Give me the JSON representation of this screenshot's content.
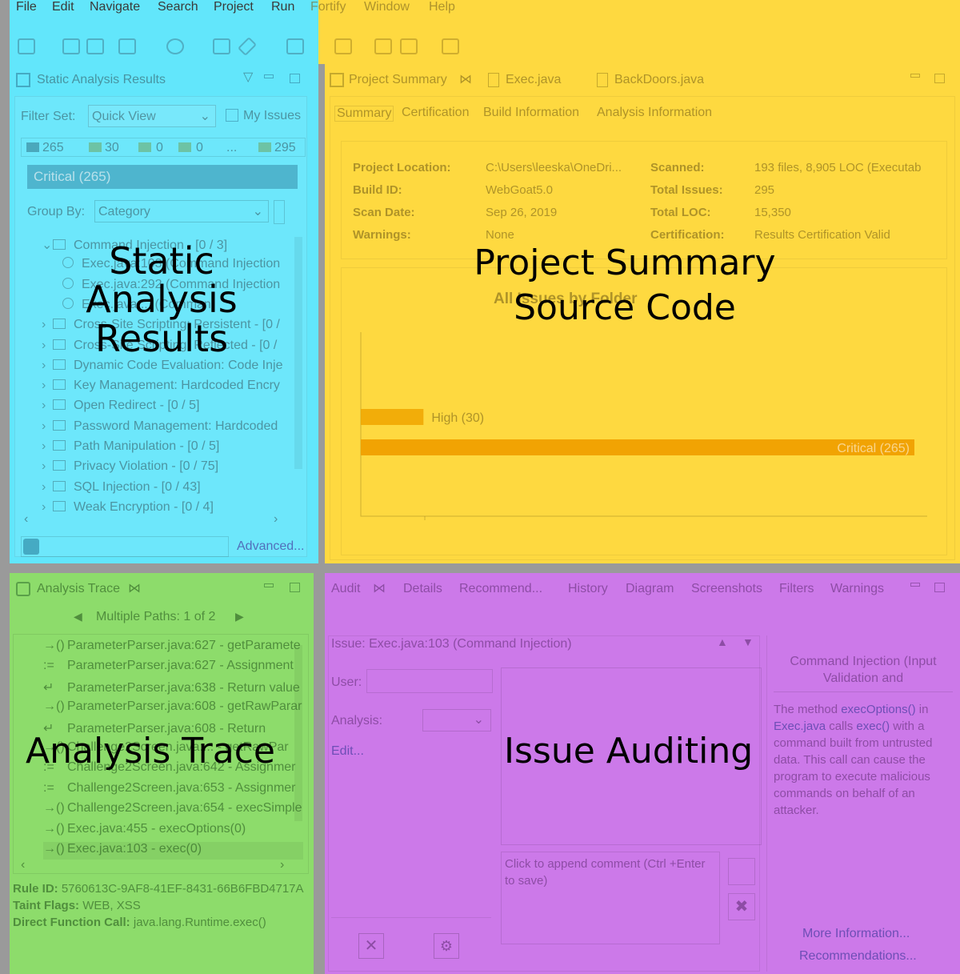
{
  "menu": [
    "File",
    "Edit",
    "Navigate",
    "Search",
    "Project",
    "Run",
    "Fortify",
    "Window",
    "Help"
  ],
  "static_panel": {
    "title": "Static Analysis Results",
    "filter_label": "Filter Set:",
    "filter_value": "Quick View",
    "my_issues": "My Issues",
    "counts": [
      "265",
      "30",
      "0",
      "0",
      "...",
      "295"
    ],
    "critical_bar": "Critical (265)",
    "group_by_label": "Group By:",
    "group_by_value": "Category",
    "tree": [
      {
        "label": "Command Injection - [0 / 3]",
        "expanded": true,
        "level": 0
      },
      {
        "label": "Exec.java:103 (Command Injection",
        "level": 1
      },
      {
        "label": "Exec.java:292 (Command Injection",
        "level": 1
      },
      {
        "label": "Exec.java:... (Comman",
        "level": 1
      },
      {
        "label": "Cross-Site Scripting: Persistent - [0 /",
        "level": 0
      },
      {
        "label": "Cross-Site Scripting: Reflected - [0 / ",
        "level": 0
      },
      {
        "label": "Dynamic Code Evaluation: Code Inje",
        "level": 0
      },
      {
        "label": "Key Management: Hardcoded Encry",
        "level": 0
      },
      {
        "label": "Open Redirect - [0 / 5]",
        "level": 0
      },
      {
        "label": "Password Management: Hardcoded",
        "level": 0
      },
      {
        "label": "Path Manipulation - [0 / 5]",
        "level": 0
      },
      {
        "label": "Privacy Violation - [0 / 75]",
        "level": 0
      },
      {
        "label": "SQL Injection - [0 / 43]",
        "level": 0
      },
      {
        "label": "Weak Encryption - [0 / 4]",
        "level": 0
      }
    ],
    "advanced_link": "Advanced...",
    "overlay": [
      "Static",
      "Analysis",
      "Results"
    ]
  },
  "summary_panel": {
    "tabs": [
      "Project Summary",
      "Exec.java",
      "BackDoors.java"
    ],
    "subtabs": [
      "Summary",
      "Certification",
      "Build Information",
      "Analysis Information"
    ],
    "fields_left": [
      {
        "label": "Project Location:",
        "value": "C:\\Users\\leeska\\OneDri..."
      },
      {
        "label": "Build ID:",
        "value": "WebGoat5.0"
      },
      {
        "label": "Scan Date:",
        "value": "Sep 26, 2019"
      },
      {
        "label": "Warnings:",
        "value": "None"
      }
    ],
    "fields_right": [
      {
        "label": "Scanned:",
        "value": "193 files, 8,905 LOC (Executab"
      },
      {
        "label": "Total Issues:",
        "value": "295"
      },
      {
        "label": "Total LOC:",
        "value": "15,350"
      },
      {
        "label": "Certification:",
        "value": "Results Certification Valid"
      }
    ],
    "chart_title": "All Issues by Folder",
    "overlay": [
      "Project Summary",
      "Source Code"
    ]
  },
  "chart_data": {
    "type": "bar",
    "orientation": "horizontal",
    "title": "All Issues by Folder",
    "categories": [
      "High",
      "Critical"
    ],
    "values": [
      30,
      265
    ],
    "data_labels": [
      "High (30)",
      "Critical (265)"
    ],
    "xlim": [
      0,
      265
    ]
  },
  "trace_panel": {
    "title": "Analysis Trace",
    "paths": "Multiple Paths:  1 of 2",
    "rows": [
      {
        "icon": "call",
        "label": "ParameterParser.java:627 - getParamete"
      },
      {
        "icon": "assign",
        "label": "ParameterParser.java:627 - Assignment"
      },
      {
        "icon": "return",
        "label": "ParameterParser.java:638 - Return value"
      },
      {
        "icon": "call",
        "label": "ParameterParser.java:608 - getRawParar"
      },
      {
        "icon": "return",
        "label": "ParameterParser.java:608 - Return"
      },
      {
        "icon": "call",
        "label": "Challenge2Screen.java:... - getRawPar"
      },
      {
        "icon": "assign",
        "label": "Challenge2Screen.java:642 - Assignmer"
      },
      {
        "icon": "assign",
        "label": "Challenge2Screen.java:653 - Assignmer"
      },
      {
        "icon": "call",
        "label": "Challenge2Screen.java:654 - execSimple"
      },
      {
        "icon": "call",
        "label": "Exec.java:455 - execOptions(0)"
      },
      {
        "icon": "call",
        "label": "Exec.java:103 - exec(0)"
      }
    ],
    "rule_id_label": "Rule ID:",
    "rule_id": "5760613C-9AF8-41EF-8431-66B6FBD4717A",
    "taint_label": "Taint Flags:",
    "taint": "WEB, XSS",
    "direct_label": "Direct Function Call:",
    "direct": "java.lang.Runtime.exec()",
    "overlay": "Analysis Trace"
  },
  "audit_panel": {
    "tabs": [
      "Audit",
      "Details",
      "Recommend...",
      "History",
      "Diagram",
      "Screenshots",
      "Filters",
      "Warnings"
    ],
    "issue": "Issue:  Exec.java:103 (Command Injection)",
    "user_label": "User:",
    "analysis_label": "Analysis:",
    "edit_link": "Edit...",
    "comment_placeholder": "Click to append comment (Ctrl +Enter to save)",
    "desc_title": "Command Injection (Input Validation and",
    "desc_pre": "The method ",
    "desc_link1": "execOptions()",
    "desc_mid1": " in ",
    "desc_link2": "Exec.java",
    "desc_mid2": " calls ",
    "desc_link3": "exec()",
    "desc_post": " with a command built from untrusted data. This call can cause the program to execute malicious commands on behalf of an attacker.",
    "more_info": "More Information...",
    "recommendations": "Recommendations...",
    "overlay": "Issue Auditing"
  }
}
